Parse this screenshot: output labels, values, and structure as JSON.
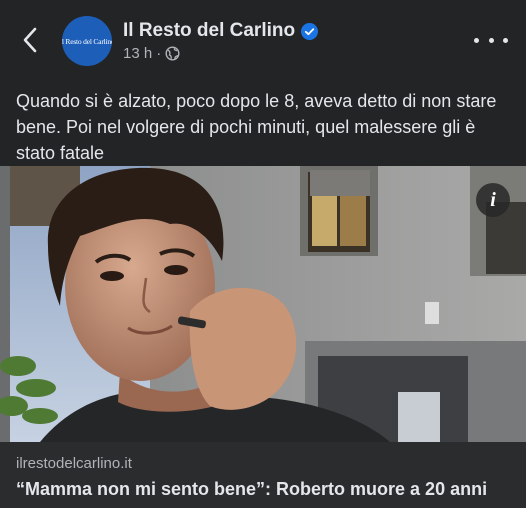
{
  "header": {
    "page_name": "Il Resto del Carlino",
    "avatar_text": "Il Resto del Carlino",
    "timestamp": "13 h",
    "separator": "·",
    "audience_icon": "globe-icon",
    "verified_icon": "verified-badge-icon",
    "back_icon": "chevron-left-icon",
    "more_icon": "more-horizontal-icon"
  },
  "post": {
    "caption": "Quando si è alzato, poco dopo le 8, aveva detto di non stare bene. Poi nel volgere di pochi minuti, quel malessere gli è stato fatale"
  },
  "image": {
    "info_label": "i"
  },
  "link_preview": {
    "domain": "ilrestodelcarlino.it",
    "title": "“Mamma non mi sento bene”: Roberto muore a 20 anni"
  },
  "colors": {
    "background": "#232426",
    "link_background": "#2b2c2e",
    "text_primary": "#e4e6eb",
    "text_secondary": "#b0b3b8",
    "brand_blue": "#1d5fb8",
    "verified_blue": "#1b74e4"
  }
}
